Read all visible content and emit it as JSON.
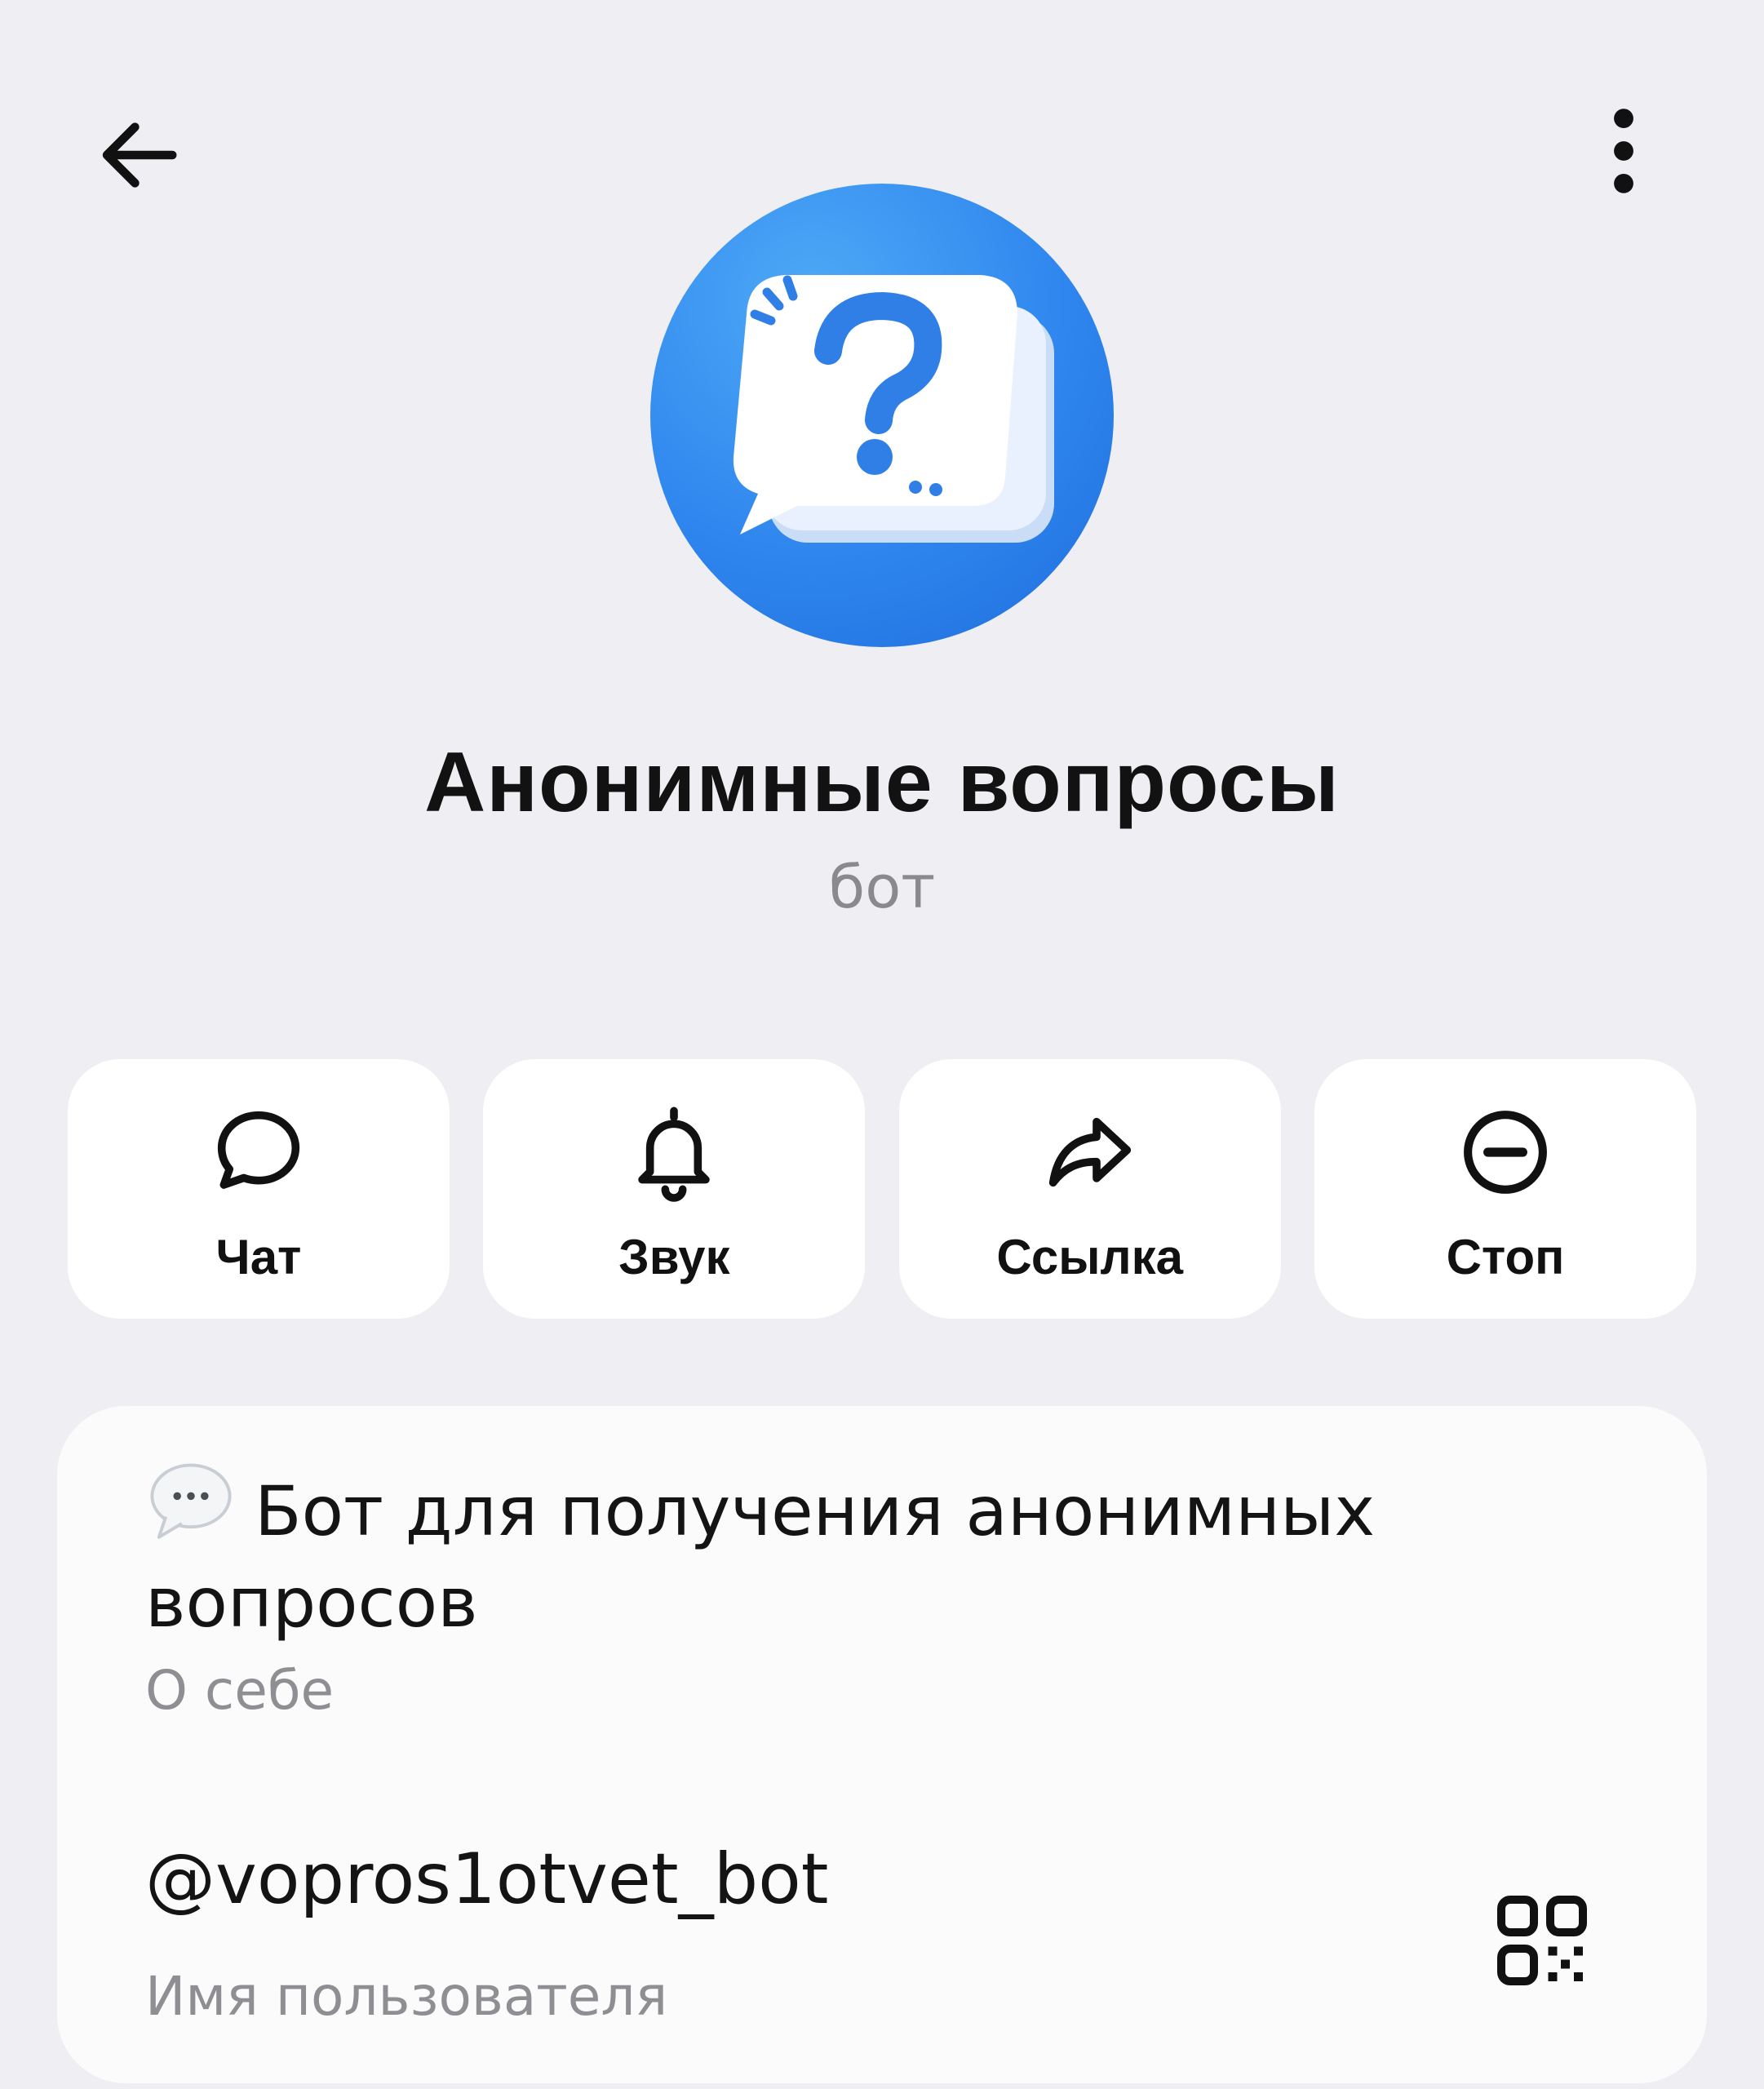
{
  "header": {
    "back_icon": "arrow-left-icon",
    "menu_icon": "more-vertical-icon"
  },
  "profile": {
    "avatar_icon": "question-chat-bubbles-icon",
    "name": "Анонимные вопросы",
    "status": "бот",
    "avatar_color": "#2f86ee"
  },
  "actions": [
    {
      "label": "Чат",
      "icon": "chat-bubble-icon"
    },
    {
      "label": "Звук",
      "icon": "bell-icon"
    },
    {
      "label": "Ссылка",
      "icon": "share-arrow-icon"
    },
    {
      "label": "Стоп",
      "icon": "block-minus-icon"
    }
  ],
  "info": {
    "bio_emoji": "speech-balloon-icon",
    "bio": "Бот для получения анонимных вопросов",
    "bio_caption": "О себе",
    "username": "@vopros1otvet_bot",
    "username_caption": "Имя пользователя",
    "qr_icon": "qr-code-icon"
  }
}
